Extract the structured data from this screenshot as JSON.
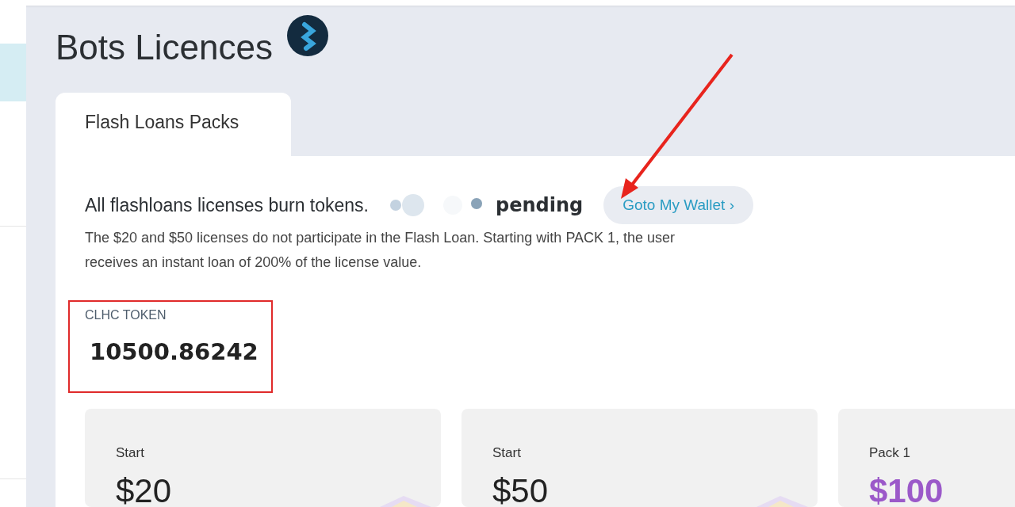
{
  "page": {
    "title": "Bots Licences"
  },
  "tabs": [
    {
      "label": "Flash Loans Packs",
      "selected": true
    }
  ],
  "notice": {
    "heading": "All flashloans licenses burn tokens.",
    "status": "pending",
    "wallet_button": "Goto My Wallet",
    "chevron": "›",
    "description": "The $20 and $50 licenses do not participate in the Flash Loan. Starting with PACK 1, the user receives an instant loan of 200% of the license value."
  },
  "token": {
    "label": "CLHC TOKEN",
    "value": "10500.86242"
  },
  "packs": [
    {
      "name": "Start",
      "price": "$20",
      "highlighted": false,
      "cube_shown": true
    },
    {
      "name": "Start",
      "price": "$50",
      "highlighted": false,
      "cube_shown": true
    },
    {
      "name": "Pack 1",
      "price": "$100",
      "highlighted": true
    }
  ]
}
